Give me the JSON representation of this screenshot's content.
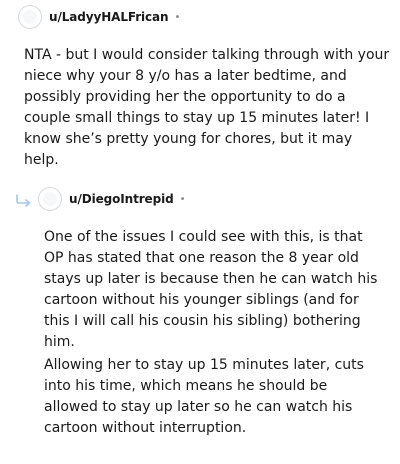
{
  "comment1": {
    "username": "u/LadyyHALFrican",
    "separator": "•",
    "body": "NTA - but I would consider talking through with your niece why your 8 y/o has a later bedtime, and possibly providing her the opportunity to do a couple small things to stay up 15 minutes later! I know she’s pretty young for chores, but it may help."
  },
  "comment2": {
    "username": "u/DiegoIntrepid",
    "separator": "•",
    "paragraphs": [
      "One of the issues I could see with this, is that OP has stated that one reason the 8 year old stays up later is because then he can watch his cartoon without his younger siblings (and for this I will call his cousin his sibling) bothering him.",
      "Allowing her to stay up 15 minutes later, cuts into his time, which means he should be allowed to stay up later so he can watch his cartoon without interruption."
    ]
  },
  "icons": {
    "avatar": "user-avatar-icon",
    "reply": "reply-arrow-icon"
  },
  "colors": {
    "text": "#1a1a1b",
    "meta": "#878a8c",
    "avatar_border": "#d7dadc",
    "reply_arrow": "#a4c8e8"
  }
}
